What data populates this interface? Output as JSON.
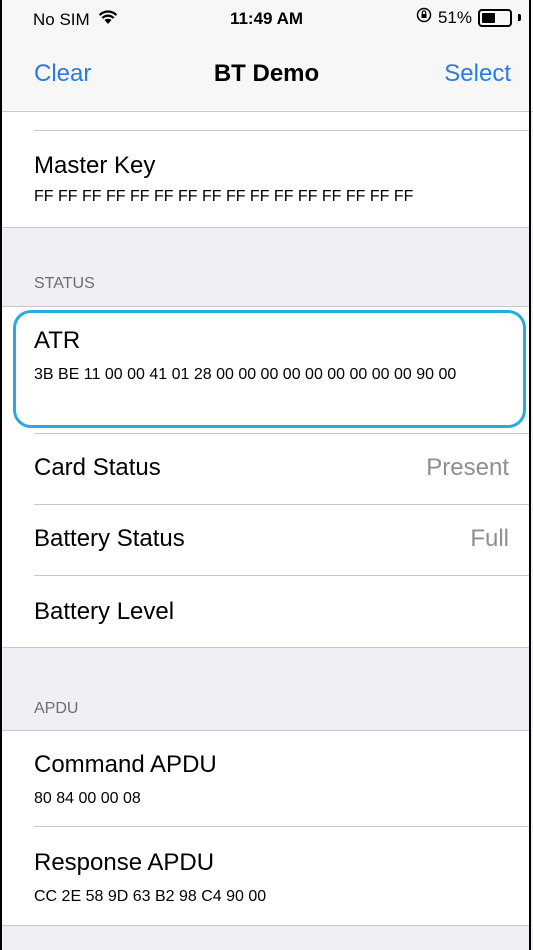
{
  "status_bar": {
    "carrier": "No SIM",
    "time": "11:49 AM",
    "battery_percent": "51%",
    "battery_level": 0.51,
    "wifi_icon": "wifi-icon",
    "rotation_lock_icon": "rotation-lock-icon"
  },
  "nav": {
    "left_label": "Clear",
    "title": "BT Demo",
    "right_label": "Select",
    "accent_color": "#2a7bdc"
  },
  "master_key": {
    "title": "Master Key",
    "value": "FF FF FF FF FF FF FF FF FF FF FF FF FF FF FF FF"
  },
  "status_section": {
    "header": "STATUS",
    "atr": {
      "title": "ATR",
      "value": "3B BE 11 00 00 41 01 28 00 00 00 00 00 00 00 00 00 90 00"
    },
    "card_status": {
      "label": "Card Status",
      "value": "Present"
    },
    "battery_status": {
      "label": "Battery Status",
      "value": "Full"
    },
    "battery_level": {
      "label": "Battery Level"
    }
  },
  "apdu_section": {
    "header": "APDU",
    "command": {
      "title": "Command APDU",
      "value": "80 84 00 00 08"
    },
    "response": {
      "title": "Response APDU",
      "value": "CC 2E 58 9D 63 B2 98 C4 90 00"
    }
  },
  "highlight_color": "#28a9e0"
}
